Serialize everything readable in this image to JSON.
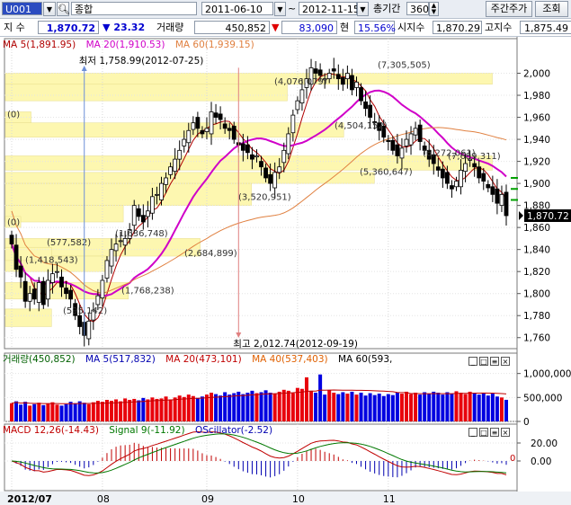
{
  "toolbar": {
    "code": "U001",
    "name": "종합",
    "date_from": "2011-06-10",
    "date_to": "2012-11-15",
    "period_label": "총기간",
    "period_value": "360",
    "weekly_button": "주간주가",
    "query_button": "조회"
  },
  "quote": {
    "index_label": "지 수",
    "price": "1,870.72",
    "change": "23.32",
    "volume_label": "거래량",
    "volume": "450,852",
    "amount": "83,090",
    "amount_unit": "현",
    "rate": "15.56%",
    "open_label": "시지수",
    "open": "1,870.29",
    "high_label": "고지수",
    "high": "1,875.49"
  },
  "price_panel": {
    "legend_ma5": "MA 5(1,891.95)",
    "legend_ma20": "MA 20(1,910.53)",
    "legend_ma60": "MA 60(1,939.15)",
    "low_note": "최저 1,758.99(2012-07-25)",
    "high_note": "최고 2,012.74(2012-09-19)",
    "current_tag": "1,870.72",
    "volume_profile_labels": [
      "(7,305,505)",
      "(4,076,079)",
      "(4,504,152)",
      "(6,272,061)",
      "(7,689,311)",
      "(5,360,647)",
      "(3,520,951)",
      "(1,636,748)",
      "(2,684,899)",
      "(1,768,238)",
      "(1,418,543)",
      "(595,142)",
      "(577,582)",
      "(0)",
      "(0)"
    ]
  },
  "volume_panel": {
    "legend_volume": "거래량(450,852)",
    "legend_ma5": "MA 5(517,832)",
    "legend_ma20": "MA 20(473,101)",
    "legend_ma40": "MA 40(537,403)",
    "legend_ma60": "MA 60(593,"
  },
  "macd_panel": {
    "legend_macd": "MACD 12,26(-14.43)",
    "legend_signal": "Signal 9(-11.92)",
    "legend_osc": "OScillator(-2.52)",
    "zero_marker": "0"
  },
  "x_labels": [
    "2012/07",
    "08",
    "09",
    "10",
    "11"
  ],
  "colors": {
    "up": "#e8000b",
    "down": "#0000e0",
    "ma5": "#b00000",
    "ma20": "#d000c8",
    "ma60": "#e08040",
    "profile": "#fdf7b0",
    "macd": "#c00000",
    "signal": "#007800",
    "osc": "#0000b0"
  },
  "chart_data": [
    {
      "type": "candlestick",
      "title": "종합",
      "ylim": [
        1750,
        2020
      ],
      "y_ticks": [
        1760,
        1780,
        1800,
        1820,
        1840,
        1860,
        1880,
        1900,
        1920,
        1940,
        1960,
        1980,
        2000
      ],
      "y_tick_labels": [
        "1,760",
        "1,780",
        "1,800",
        "1,820",
        "1,840",
        "1,860",
        "1,880",
        "1,900",
        "1,920",
        "1,940",
        "1,960",
        "1,980",
        "2,000"
      ],
      "x_month_labels": [
        "2012/07",
        "08",
        "09",
        "10",
        "11"
      ],
      "x_month_index": [
        0,
        20,
        43,
        63,
        83
      ],
      "close": [
        1845,
        1822,
        1815,
        1793,
        1800,
        1795,
        1810,
        1790,
        1812,
        1818,
        1820,
        1806,
        1800,
        1795,
        1780,
        1770,
        1762,
        1775,
        1785,
        1798,
        1812,
        1830,
        1840,
        1845,
        1848,
        1850,
        1858,
        1880,
        1870,
        1865,
        1875,
        1888,
        1890,
        1900,
        1905,
        1915,
        1922,
        1930,
        1940,
        1948,
        1955,
        1950,
        1945,
        1950,
        1965,
        1960,
        1958,
        1950,
        1948,
        1940,
        1935,
        1930,
        1928,
        1922,
        1925,
        1915,
        1905,
        1900,
        1910,
        1915,
        1930,
        1945,
        1962,
        1975,
        1985,
        1995,
        2005,
        2000,
        1998,
        1995,
        2000,
        2002,
        1995,
        1990,
        2000,
        1985,
        1992,
        1975,
        1968,
        1960,
        1955,
        1948,
        1942,
        1938,
        1930,
        1925,
        1932,
        1940,
        1945,
        1950,
        1938,
        1930,
        1922,
        1918,
        1912,
        1905,
        1900,
        1895,
        1902,
        1912,
        1918,
        1922,
        1915,
        1905,
        1902,
        1896,
        1890,
        1882,
        1890,
        1870.72
      ],
      "ma5": 1891.95,
      "ma20": 1910.53,
      "ma60": 1939.15,
      "low": {
        "value": 1758.99,
        "date": "2012-07-25"
      },
      "high": {
        "value": 2012.74,
        "date": "2012-09-19"
      },
      "last": 1870.72
    },
    {
      "type": "bar",
      "title": "거래량",
      "ylim": [
        0,
        1200000
      ],
      "y_ticks": [
        0,
        500000,
        1000000
      ],
      "y_tick_labels": [
        "0",
        "500,000",
        "1,000,000"
      ],
      "values": [
        380000,
        420000,
        350000,
        410000,
        330000,
        360000,
        390000,
        340000,
        370000,
        400000,
        350000,
        330000,
        360000,
        410000,
        380000,
        420000,
        390000,
        360000,
        400000,
        430000,
        410000,
        450000,
        430000,
        460000,
        420000,
        480000,
        450000,
        470000,
        440000,
        490000,
        460000,
        500000,
        470000,
        480000,
        520000,
        460000,
        500000,
        540000,
        510000,
        560000,
        530000,
        490000,
        520000,
        560000,
        600000,
        570000,
        540000,
        610000,
        560000,
        590000,
        620000,
        570000,
        600000,
        640000,
        590000,
        610000,
        650000,
        600000,
        580000,
        620000,
        660000,
        640000,
        590000,
        700000,
        680000,
        920000,
        640000,
        600000,
        980000,
        560000,
        650000,
        600000,
        570000,
        610000,
        580000,
        620000,
        560000,
        600000,
        540000,
        590000,
        550000,
        580000,
        530000,
        570000,
        550000,
        600000,
        580000,
        620000,
        570000,
        600000,
        560000,
        610000,
        580000,
        620000,
        600000,
        560000,
        610000,
        580000,
        630000,
        600000,
        570000,
        620000,
        590000,
        560000,
        600000,
        540000,
        580000,
        520000,
        500000,
        450852
      ],
      "ma5": 517832,
      "ma20": 473101,
      "ma40": 537403
    },
    {
      "type": "line",
      "title": "MACD",
      "ylim": [
        -25,
        35
      ],
      "y_ticks": [
        0,
        20
      ],
      "y_tick_labels": [
        "0.00",
        "20.00"
      ],
      "series": [
        {
          "name": "MACD 12,26",
          "last": -14.43
        },
        {
          "name": "Signal 9",
          "last": -11.92
        },
        {
          "name": "OScillator",
          "last": -2.52
        }
      ]
    }
  ]
}
